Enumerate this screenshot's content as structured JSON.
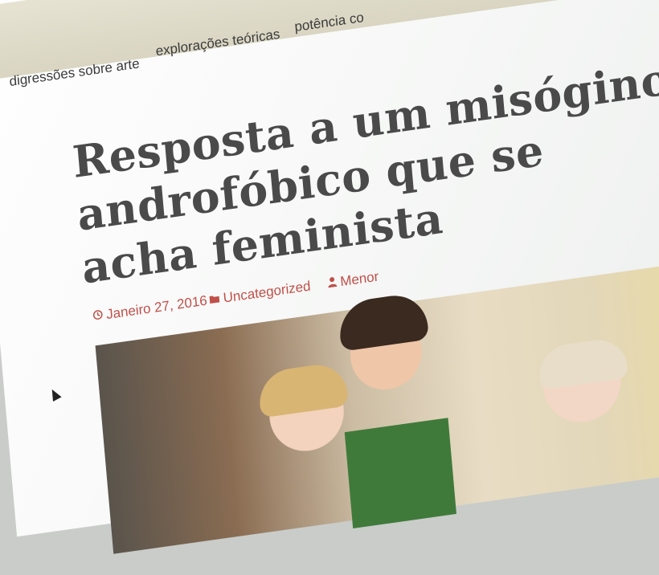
{
  "nav": {
    "items": [
      {
        "label": "digressões sobre arte"
      },
      {
        "label": "explorações teóricas"
      },
      {
        "label": "potência co"
      }
    ]
  },
  "post": {
    "title_lines": [
      "Resposta a um misógino",
      "androfóbico que se",
      "acha feminista"
    ],
    "meta": {
      "date": "Janeiro 27, 2016",
      "category": "Uncategorized",
      "author": "Menor",
      "date_icon": "clock-icon",
      "category_icon": "folder-icon",
      "author_icon": "user-icon"
    }
  },
  "colors": {
    "accent": "#c0504a",
    "title": "#4a4a4a",
    "nav_bg": "#dedac8"
  }
}
